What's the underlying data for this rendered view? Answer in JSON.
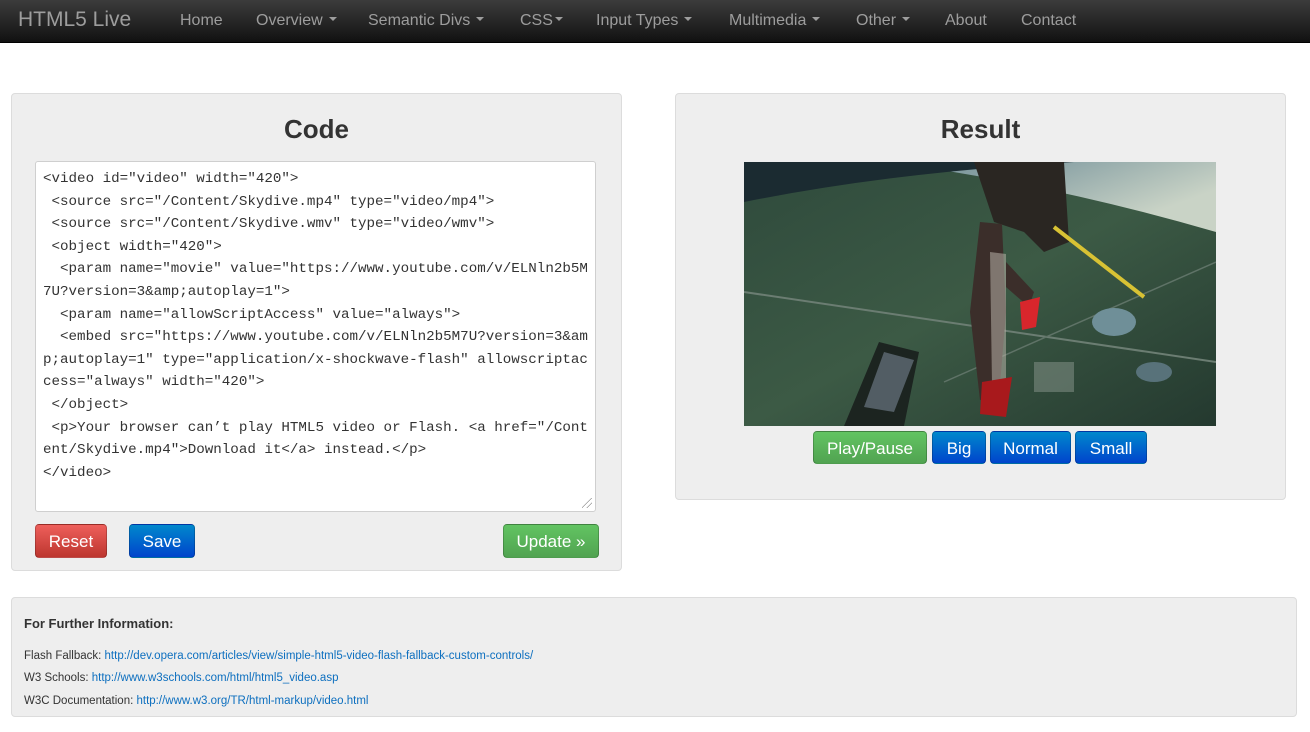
{
  "navbar": {
    "brand": "HTML5 Live",
    "items": [
      {
        "label": "Home",
        "dropdown": false
      },
      {
        "label": "Overview",
        "dropdown": true
      },
      {
        "label": "Semantic Divs",
        "dropdown": true
      },
      {
        "label": "CSS",
        "dropdown": true
      },
      {
        "label": "Input Types",
        "dropdown": true
      },
      {
        "label": "Multimedia",
        "dropdown": true
      },
      {
        "label": "Other",
        "dropdown": true
      },
      {
        "label": "About",
        "dropdown": false
      },
      {
        "label": "Contact",
        "dropdown": false
      }
    ]
  },
  "code_panel": {
    "title": "Code",
    "code": "<video id=\"video\" width=\"420\">\n <source src=\"/Content/Skydive.mp4\" type=\"video/mp4\">\n <source src=\"/Content/Skydive.wmv\" type=\"video/wmv\">\n <object width=\"420\">\n  <param name=\"movie\" value=\"https://www.youtube.com/v/ELNln2b5M7U?version=3&amp;autoplay=1\">\n  <param name=\"allowScriptAccess\" value=\"always\">\n  <embed src=\"https://www.youtube.com/v/ELNln2b5M7U?version=3&amp;autoplay=1\" type=\"application/x-shockwave-flash\" allowscriptaccess=\"always\" width=\"420\">\n </object>\n <p>Your browser can’t play HTML5 video or Flash. <a href=\"/Content/Skydive.mp4\">Download it</a> instead.</p>\n</video>",
    "reset_label": "Reset",
    "save_label": "Save",
    "update_label": "Update »"
  },
  "result_panel": {
    "title": "Result",
    "play_pause_label": "Play/Pause",
    "big_label": "Big",
    "normal_label": "Normal",
    "small_label": "Small"
  },
  "info": {
    "title": "For Further Information:",
    "links": [
      {
        "label": "Flash Fallback: ",
        "url": "http://dev.opera.com/articles/view/simple-html5-video-flash-fallback-custom-controls/"
      },
      {
        "label": "W3 Schools: ",
        "url": "http://www.w3schools.com/html/html5_video.asp"
      },
      {
        "label": "W3C Documentation: ",
        "url": "http://www.w3.org/TR/html-markup/video.html"
      }
    ]
  },
  "colors": {
    "navbar": "#222222",
    "danger": "#d9534f",
    "primary": "#0055cc",
    "success": "#5cb85c",
    "link": "#0d6fbf"
  }
}
